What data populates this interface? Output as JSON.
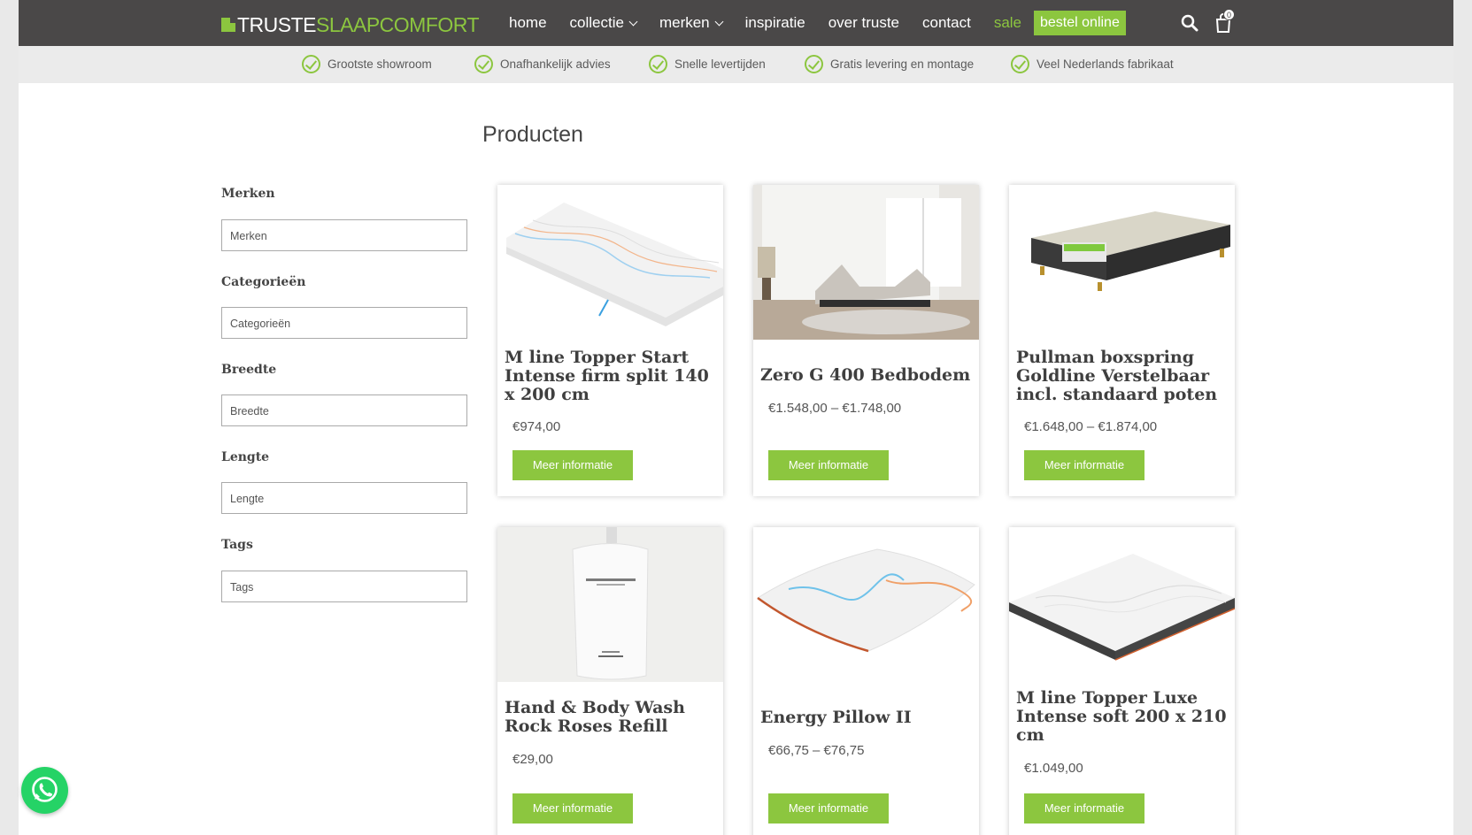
{
  "header": {
    "logo_part1": "TRUSTE",
    "logo_part2": "SLAAPCOMFORT",
    "nav": [
      {
        "label": "home",
        "has_dropdown": false
      },
      {
        "label": "collectie",
        "has_dropdown": true
      },
      {
        "label": "merken",
        "has_dropdown": true
      },
      {
        "label": "inspiratie",
        "has_dropdown": false
      },
      {
        "label": "over truste",
        "has_dropdown": false
      },
      {
        "label": "contact",
        "has_dropdown": false
      }
    ],
    "sale_label": "sale",
    "cta_label": "bestel online",
    "cart_count": "0",
    "icons": {
      "search": "search-icon",
      "cart": "shopping-bag-icon"
    }
  },
  "usp_bar": [
    "Grootste showroom",
    "Onafhankelijk advies",
    "Snelle levertijden",
    "Gratis levering en montage",
    "Veel Nederlands fabrikaat"
  ],
  "page_title": "Producten",
  "filters": [
    {
      "label": "Merken",
      "placeholder": "Merken"
    },
    {
      "label": "Categorieën",
      "placeholder": "Categorieën"
    },
    {
      "label": "Breedte",
      "placeholder": "Breedte"
    },
    {
      "label": "Lengte",
      "placeholder": "Lengte"
    },
    {
      "label": "Tags",
      "placeholder": "Tags"
    }
  ],
  "products": [
    {
      "title": "M line Topper Start Intense firm split 140 x 200 cm",
      "price": "€974,00",
      "button": "Meer informatie",
      "image": "topper-split"
    },
    {
      "title": "Zero G 400 Bedbodem",
      "price": "€1.548,00 – €1.748,00",
      "button": "Meer informatie",
      "image": "adjustable-bed-room"
    },
    {
      "title": "Pullman boxspring Goldline Verstelbaar incl. standaard poten",
      "price": "€1.648,00 – €1.874,00",
      "button": "Meer informatie",
      "image": "boxspring"
    },
    {
      "title": "Hand & Body Wash Rock Roses Refill",
      "price": "€29,00",
      "button": "Meer informatie",
      "image": "refill-pouch"
    },
    {
      "title": "Energy Pillow II",
      "price": "€66,75 – €76,75",
      "button": "Meer informatie",
      "image": "pillow"
    },
    {
      "title": "M line Topper Luxe Intense soft 200 x 210 cm",
      "price": "€1.049,00",
      "button": "Meer informatie",
      "image": "topper-luxe"
    }
  ],
  "colors": {
    "accent": "#8cc63f",
    "header_bg": "#4a4848",
    "usp_bg": "#ebebeb",
    "whatsapp": "#25d366"
  },
  "floating": {
    "whatsapp_icon": "whatsapp-icon"
  }
}
